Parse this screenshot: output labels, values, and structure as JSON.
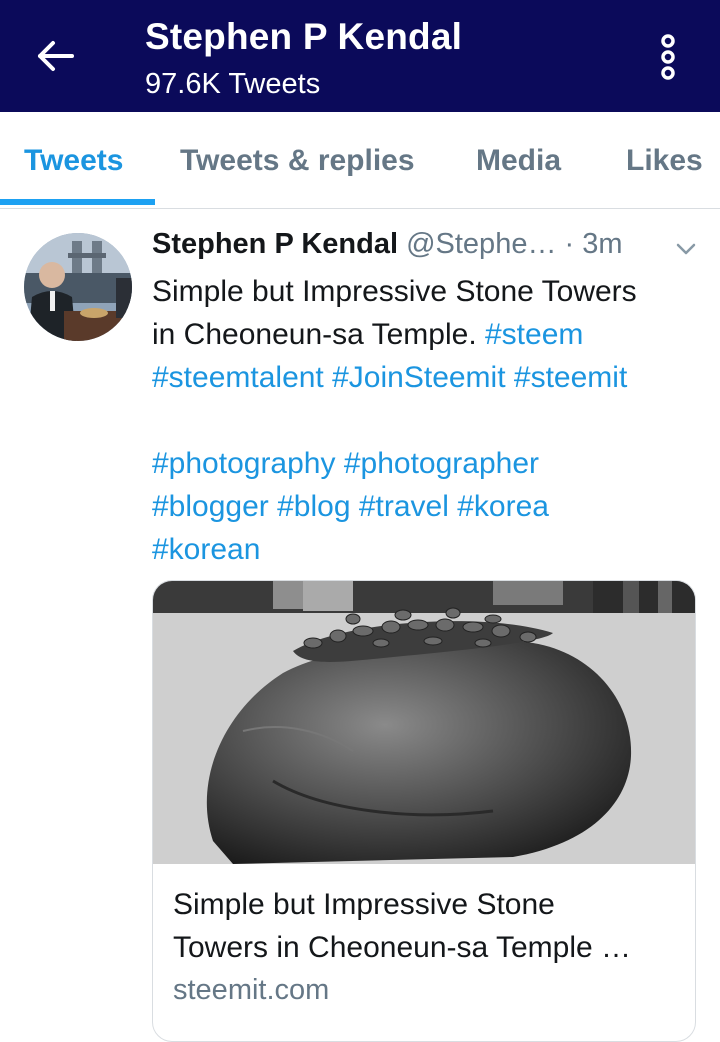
{
  "header": {
    "title": "Stephen P Kendal",
    "subtitle": "97.6K Tweets",
    "background": "#0b0a5a"
  },
  "icons": {
    "back": "arrow-left-icon",
    "more": "vertical-dots-icon",
    "caret": "chevron-down-icon"
  },
  "tabs": [
    {
      "label": "Tweets",
      "active": true
    },
    {
      "label": "Tweets & replies",
      "active": false
    },
    {
      "label": "Media",
      "active": false
    },
    {
      "label": "Likes",
      "active": false
    }
  ],
  "tweet": {
    "author_name": "Stephen P Kendal",
    "author_handle": "@Stephe…",
    "separator": "·",
    "time": "3m",
    "text_plain_1": "Simple but Impressive Stone Towers",
    "text_plain_2": "in Cheoneun-sa Temple.",
    "tags": [
      "#steem",
      "#steemtalent",
      "#JoinSteemit",
      "#steemit",
      "#photography",
      "#photographer",
      "#blogger",
      "#blog",
      "#travel",
      "#korea",
      "#korean"
    ],
    "card": {
      "title_line1": "Simple but Impressive Stone",
      "title_line2": "Towers in Cheoneun-sa Temple …",
      "domain": "steemit.com"
    }
  },
  "colors": {
    "accent": "#1b95e0",
    "muted": "#657786",
    "text": "#14171a"
  }
}
